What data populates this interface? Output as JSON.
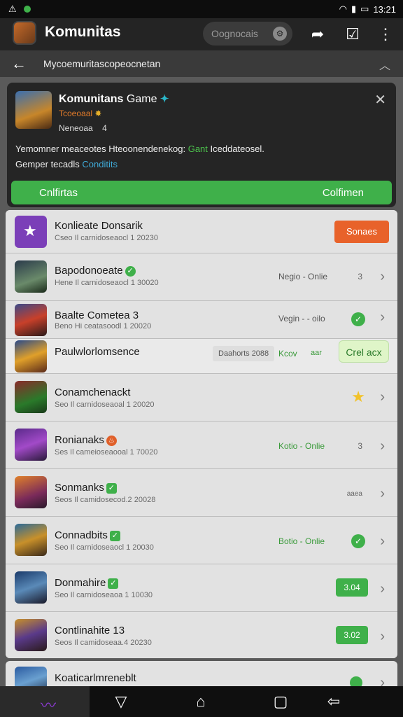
{
  "status_bar": {
    "time": "13:21"
  },
  "app_bar": {
    "title": "Komunitas",
    "search_placeholder": "Oognocais"
  },
  "sub_bar": {
    "breadcrumb": "Mycoemuritascopeocnetan"
  },
  "community": {
    "name": "Komunitans",
    "name_tail": " Game",
    "line1": "Tcoeoaal",
    "line2": "Neneoaa",
    "line2_value": "4",
    "desc_a": "Yemomner meaceotes Hteoonendenekog:",
    "desc_green": "Gant",
    "desc_b": "Iceddateosel.",
    "desc_c": "Gemper tecadls",
    "desc_blue": "Conditits",
    "cta_left": "Cnlfirtas",
    "cta_right": "Colfimen"
  },
  "rows": [
    {
      "name": "Konlieate Donsarik",
      "meta": "Cseo Il carnidoseaocl 1 20230",
      "action": "Sonaes"
    },
    {
      "name": "Bapodonoeate",
      "meta": "Hene Il carnidoseaocl 1 30020",
      "status": "Negio - Onlie",
      "count": "3"
    },
    {
      "name": "Baalte Cometea 3",
      "meta": "Beno Hi ceatasoodl 1 20020",
      "status": "Vegin - - oilo"
    },
    {
      "name": "Paulwlorlomsence",
      "tag": "Daahorts 2088",
      "status_a": "Kcov",
      "status_b": "aar",
      "action": "Crel acx"
    },
    {
      "name": "Conamchenackt",
      "meta": "Seo Il carnidoseaoal 1 20020"
    },
    {
      "name": "Ronianaks",
      "meta": "Ses Il cameioseaooal 1 70020",
      "status": "Kotio - Onlie",
      "count": "3"
    },
    {
      "name": "Sonmanks",
      "meta": "Seos Il camidosecod.2 20028",
      "count": "aaea"
    },
    {
      "name": "Connadbits",
      "meta": "Seo Il carnidoseaocl 1 20030",
      "status": "Botio - Onlie"
    },
    {
      "name": "Donmahire",
      "meta": "Seo Il carnidoseaoa 1 10030",
      "pill": "3.04"
    },
    {
      "name": "Contlinahite 13",
      "meta": "Seos Il camidoseaa.4 20230",
      "pill": "3.02"
    }
  ],
  "bottom_row": {
    "name": "Koaticarlmreneblt"
  }
}
